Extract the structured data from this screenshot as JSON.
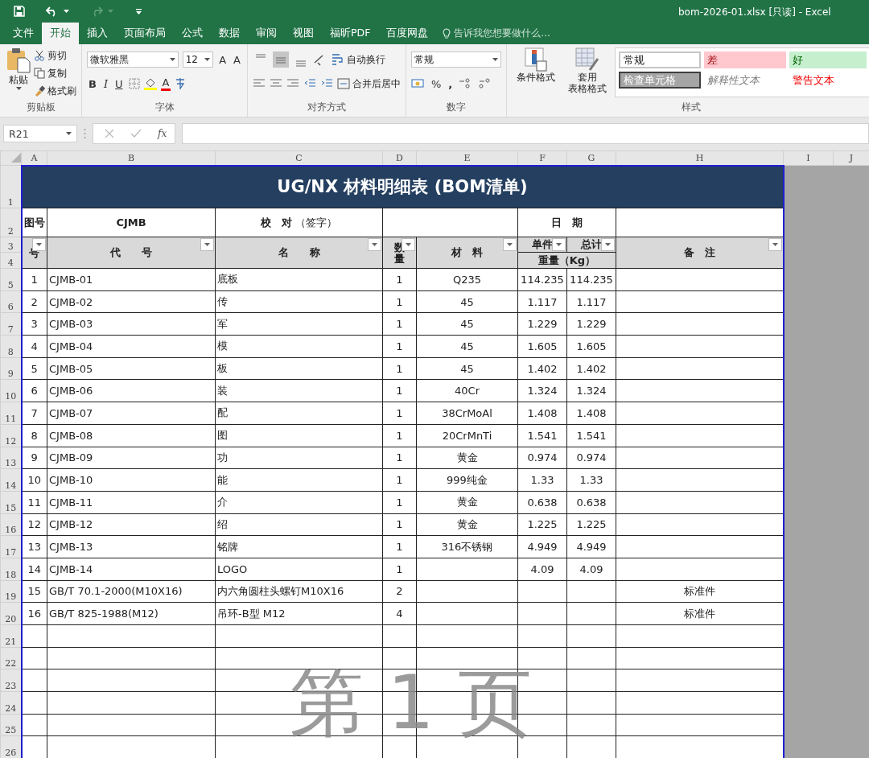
{
  "window": {
    "title": "bom-2026-01.xlsx  [只读] - Excel"
  },
  "tabs": [
    {
      "label": "文件",
      "selected": false
    },
    {
      "label": "开始",
      "selected": true
    },
    {
      "label": "插入",
      "selected": false
    },
    {
      "label": "页面布局",
      "selected": false
    },
    {
      "label": "公式",
      "selected": false
    },
    {
      "label": "数据",
      "selected": false
    },
    {
      "label": "审阅",
      "selected": false
    },
    {
      "label": "视图",
      "selected": false
    },
    {
      "label": "福昕PDF",
      "selected": false
    },
    {
      "label": "百度网盘",
      "selected": false
    }
  ],
  "tell_me": {
    "placeholder": "告诉我您想要做什么..."
  },
  "ribbon": {
    "clipboard": {
      "paste": "粘贴",
      "cut": "剪切",
      "copy": "复制",
      "painter": "格式刷",
      "label": "剪贴板"
    },
    "font": {
      "family": "微软雅黑",
      "size": "12",
      "grow": "A",
      "shrink": "A",
      "bold": "B",
      "italic": "I",
      "underline": "U",
      "color_letter": "A",
      "label": "字体"
    },
    "alignment": {
      "vertical_align": [
        {
          "selected": false
        },
        {
          "selected": true
        },
        {
          "selected": false
        }
      ],
      "wrap": "自动换行",
      "merge": "合并后居中",
      "label": "对齐方式"
    },
    "number": {
      "format": "常规",
      "percent": "%",
      "comma": ",",
      "label": "数字"
    },
    "styles": {
      "conditional": "条件格式",
      "table_format_1": "套用",
      "table_format_2": "表格格式",
      "cells": [
        {
          "label": "常规",
          "kind": "normal"
        },
        {
          "label": "差",
          "kind": "bad"
        },
        {
          "label": "好",
          "kind": "good"
        },
        {
          "label": "检查单元格",
          "kind": "check"
        },
        {
          "label": "解释性文本",
          "kind": "explanatory"
        },
        {
          "label": "警告文本",
          "kind": "warning"
        }
      ],
      "label": "样式"
    }
  },
  "formula_bar": {
    "name_box": "R21",
    "fx": "fx"
  },
  "sheet": {
    "columns": [
      "A",
      "B",
      "C",
      "D",
      "E",
      "F",
      "G",
      "H",
      "I",
      "J"
    ],
    "title": "UG/NX 材料明细表 (BOM清单)",
    "header_row_numbers": [
      "1",
      "2",
      "3",
      "4"
    ],
    "info": {
      "drawing_no_label": "图号",
      "drawing_no": "CJMB",
      "check": "**校　对** （签字）",
      "date_label": "日　期"
    },
    "headers": [
      {
        "label": "号",
        "filter": true
      },
      {
        "label": "代　　号",
        "filter": true
      },
      {
        "label": "名　　称",
        "filter": true
      },
      {
        "label": "数量",
        "filter": true
      },
      {
        "label": "材　料",
        "filter": true
      },
      {
        "label": "单件",
        "filter": true
      },
      {
        "label": "总计",
        "filter": true
      },
      {
        "label": "重量（Kg）",
        "filter": false
      },
      {
        "label": "备　注",
        "filter": true
      }
    ],
    "rows": [
      {
        "row": "5",
        "no": "1",
        "code": "CJMB-01",
        "name": "底板",
        "qty": "1",
        "material": "Q235",
        "unit": "114.235",
        "total": "114.235",
        "note": ""
      },
      {
        "row": "6",
        "no": "2",
        "code": "CJMB-02",
        "name": "传",
        "qty": "1",
        "material": "45",
        "unit": "1.117",
        "total": "1.117",
        "note": ""
      },
      {
        "row": "7",
        "no": "3",
        "code": "CJMB-03",
        "name": "军",
        "qty": "1",
        "material": "45",
        "unit": "1.229",
        "total": "1.229",
        "note": ""
      },
      {
        "row": "8",
        "no": "4",
        "code": "CJMB-04",
        "name": "模",
        "qty": "1",
        "material": "45",
        "unit": "1.605",
        "total": "1.605",
        "note": ""
      },
      {
        "row": "9",
        "no": "5",
        "code": "CJMB-05",
        "name": "板",
        "qty": "1",
        "material": "45",
        "unit": "1.402",
        "total": "1.402",
        "note": ""
      },
      {
        "row": "10",
        "no": "6",
        "code": "CJMB-06",
        "name": "装",
        "qty": "1",
        "material": "40Cr",
        "unit": "1.324",
        "total": "1.324",
        "note": ""
      },
      {
        "row": "11",
        "no": "7",
        "code": "CJMB-07",
        "name": "配",
        "qty": "1",
        "material": "38CrMoAl",
        "unit": "1.408",
        "total": "1.408",
        "note": ""
      },
      {
        "row": "12",
        "no": "8",
        "code": "CJMB-08",
        "name": "图",
        "qty": "1",
        "material": "20CrMnTi",
        "unit": "1.541",
        "total": "1.541",
        "note": ""
      },
      {
        "row": "13",
        "no": "9",
        "code": "CJMB-09",
        "name": "功",
        "qty": "1",
        "material": "黄金",
        "unit": "0.974",
        "total": "0.974",
        "note": ""
      },
      {
        "row": "14",
        "no": "10",
        "code": "CJMB-10",
        "name": "能",
        "qty": "1",
        "material": "999纯金",
        "unit": "1.33",
        "total": "1.33",
        "note": ""
      },
      {
        "row": "15",
        "no": "11",
        "code": "CJMB-11",
        "name": "介",
        "qty": "1",
        "material": "黄金",
        "unit": "0.638",
        "total": "0.638",
        "note": ""
      },
      {
        "row": "16",
        "no": "12",
        "code": "CJMB-12",
        "name": "绍",
        "qty": "1",
        "material": "黄金",
        "unit": "1.225",
        "total": "1.225",
        "note": ""
      },
      {
        "row": "17",
        "no": "13",
        "code": "CJMB-13",
        "name": "铭牌",
        "qty": "1",
        "material": "316不锈钢",
        "unit": "4.949",
        "total": "4.949",
        "note": ""
      },
      {
        "row": "18",
        "no": "14",
        "code": "CJMB-14",
        "name": "LOGO",
        "qty": "1",
        "material": "",
        "unit": "4.09",
        "total": "4.09",
        "note": ""
      },
      {
        "row": "19",
        "no": "15",
        "code": "GB/T 70.1-2000(M10X16)",
        "name": "内六角圆柱头螺钉M10X16",
        "qty": "2",
        "material": "",
        "unit": "",
        "total": "",
        "note": "标准件"
      },
      {
        "row": "20",
        "no": "16",
        "code": "GB/T 825-1988(M12)",
        "name": "吊环-B型 M12",
        "qty": "4",
        "material": "",
        "unit": "",
        "total": "",
        "note": "标准件"
      }
    ],
    "empty_row_numbers": [
      "21",
      "22",
      "23",
      "24",
      "25",
      "26"
    ],
    "page_label": "第 1 页"
  }
}
